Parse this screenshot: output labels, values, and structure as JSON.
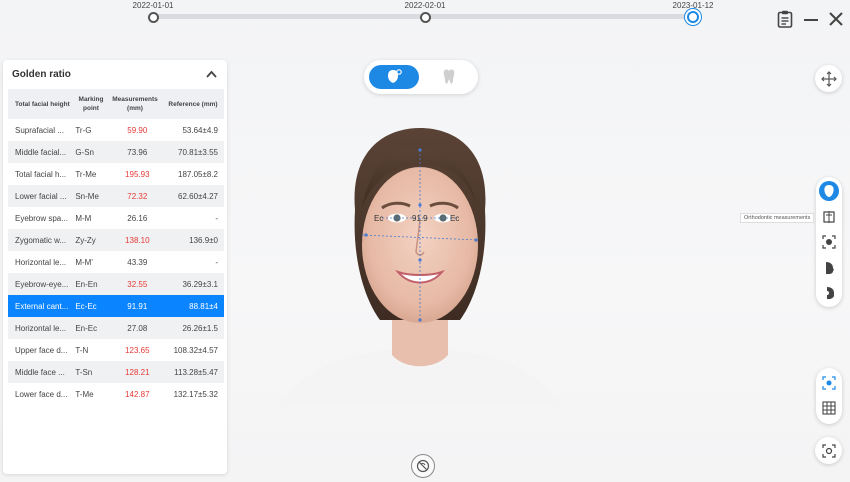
{
  "timeline": {
    "dates": [
      "2022-01-01",
      "2022-02-01",
      "2023-01-12"
    ],
    "selected": "2023-01-12"
  },
  "window_controls": [
    "clipboard-icon",
    "minimize-icon",
    "close-icon"
  ],
  "panel": {
    "title": "Golden ratio",
    "columns": {
      "name": "Total facial height",
      "point": "Marking point",
      "measurement": "Measurements (mm)",
      "reference": "Reference (mm)"
    },
    "rows": [
      {
        "name": "Suprafacial ...",
        "point": "Tr-G",
        "measurement": "59.90",
        "reference": "53.64±4.9",
        "abnormal": true
      },
      {
        "name": "Middle facial...",
        "point": "G-Sn",
        "measurement": "73.96",
        "reference": "70.81±3.55",
        "abnormal": false
      },
      {
        "name": "Total facial h...",
        "point": "Tr-Me",
        "measurement": "195.93",
        "reference": "187.05±8.2",
        "abnormal": true
      },
      {
        "name": "Lower facial ...",
        "point": "Sn-Me",
        "measurement": "72.32",
        "reference": "62.60±4.27",
        "abnormal": true
      },
      {
        "name": "Eyebrow spa...",
        "point": "M-M",
        "measurement": "26.16",
        "reference": "-",
        "abnormal": false
      },
      {
        "name": "Zygomatic w...",
        "point": "Zy-Zy",
        "measurement": "138.10",
        "reference": "136.9±0",
        "abnormal": true
      },
      {
        "name": "Horizontal le...",
        "point": "M-M'",
        "measurement": "43.39",
        "reference": "-",
        "abnormal": false
      },
      {
        "name": "Eyebrow-eye...",
        "point": "En-En",
        "measurement": "32.55",
        "reference": "36.29±3.1",
        "abnormal": true
      },
      {
        "name": "External cant...",
        "point": "Ec-Ec",
        "measurement": "91.91",
        "reference": "88.81±4",
        "abnormal": false,
        "selected": true
      },
      {
        "name": "Horizontal le...",
        "point": "En-Ec",
        "measurement": "27.08",
        "reference": "26.26±1.5",
        "abnormal": false
      },
      {
        "name": "Upper face d...",
        "point": "T-N",
        "measurement": "123.65",
        "reference": "108.32±4.57",
        "abnormal": true
      },
      {
        "name": "Middle face ...",
        "point": "T-Sn",
        "measurement": "128.21",
        "reference": "113.28±5.47",
        "abnormal": true
      },
      {
        "name": "Lower face d...",
        "point": "T-Me",
        "measurement": "142.87",
        "reference": "132.17±5.32",
        "abnormal": true
      }
    ]
  },
  "face": {
    "label_left": "Ec",
    "label_value": "91.9",
    "label_right": "Ec"
  },
  "view_toggle": {
    "options": [
      "face-scan-icon",
      "tooth-icon"
    ],
    "active": "face-scan-icon"
  },
  "side_tools": {
    "tooltip": "Orthodontic measurements",
    "tools": [
      "head-profile-icon",
      "orthodontic-measure-icon",
      "face-scan-icon",
      "side-profile-icon",
      "side-profile-alt-icon"
    ]
  },
  "colors": {
    "accent": "#1e88e5",
    "selected_row": "#0a84ff",
    "abnormal": "#e53935"
  }
}
